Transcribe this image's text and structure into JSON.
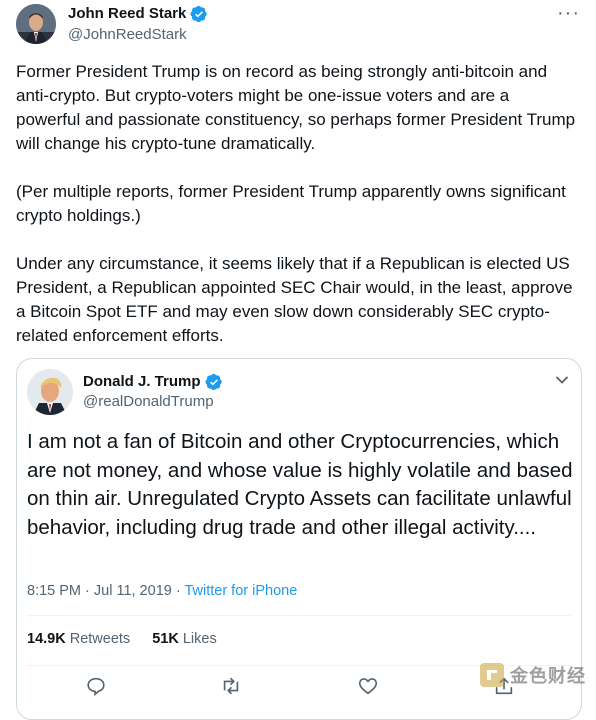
{
  "tweet": {
    "author_name": "John Reed Stark",
    "author_handle": "@JohnReedStark",
    "more_label": "···",
    "paragraphs": [
      "Former President Trump is on record as being strongly anti-bitcoin and anti-crypto. But crypto-voters might be one-issue voters and are a powerful and passionate constituency, so perhaps former President Trump will change his crypto-tune dramatically.",
      "(Per multiple reports, former President Trump apparently owns significant crypto holdings.)",
      "Under any circumstance, it seems likely that if a Republican is elected US President, a Republican appointed SEC Chair would, in the least, approve a Bitcoin Spot ETF and may even slow down considerably SEC crypto-related enforcement efforts."
    ]
  },
  "quoted": {
    "author_name": "Donald J. Trump",
    "author_handle": "@realDonaldTrump",
    "text": "I am not a fan of Bitcoin and other Cryptocurrencies, which are not money, and whose value is highly volatile and based on thin air. Unregulated Crypto Assets can facilitate unlawful behavior, including drug trade and other illegal activity....",
    "timestamp": "8:15 PM · Jul 11, 2019 · ",
    "source": "Twitter for iPhone",
    "retweets_count": "14.9K",
    "retweets_label": "Retweets",
    "likes_count": "51K",
    "likes_label": "Likes"
  },
  "watermark": "金色财经",
  "icons": {
    "verified": "verified-badge-icon",
    "more": "more-icon",
    "chevron": "chevron-down-icon",
    "reply": "reply-icon",
    "retweet": "retweet-icon",
    "like": "like-icon",
    "share": "share-icon"
  },
  "colors": {
    "accent": "#1d9bf0",
    "text": "#0f1419",
    "secondary": "#536471",
    "border": "#cfd9de"
  }
}
